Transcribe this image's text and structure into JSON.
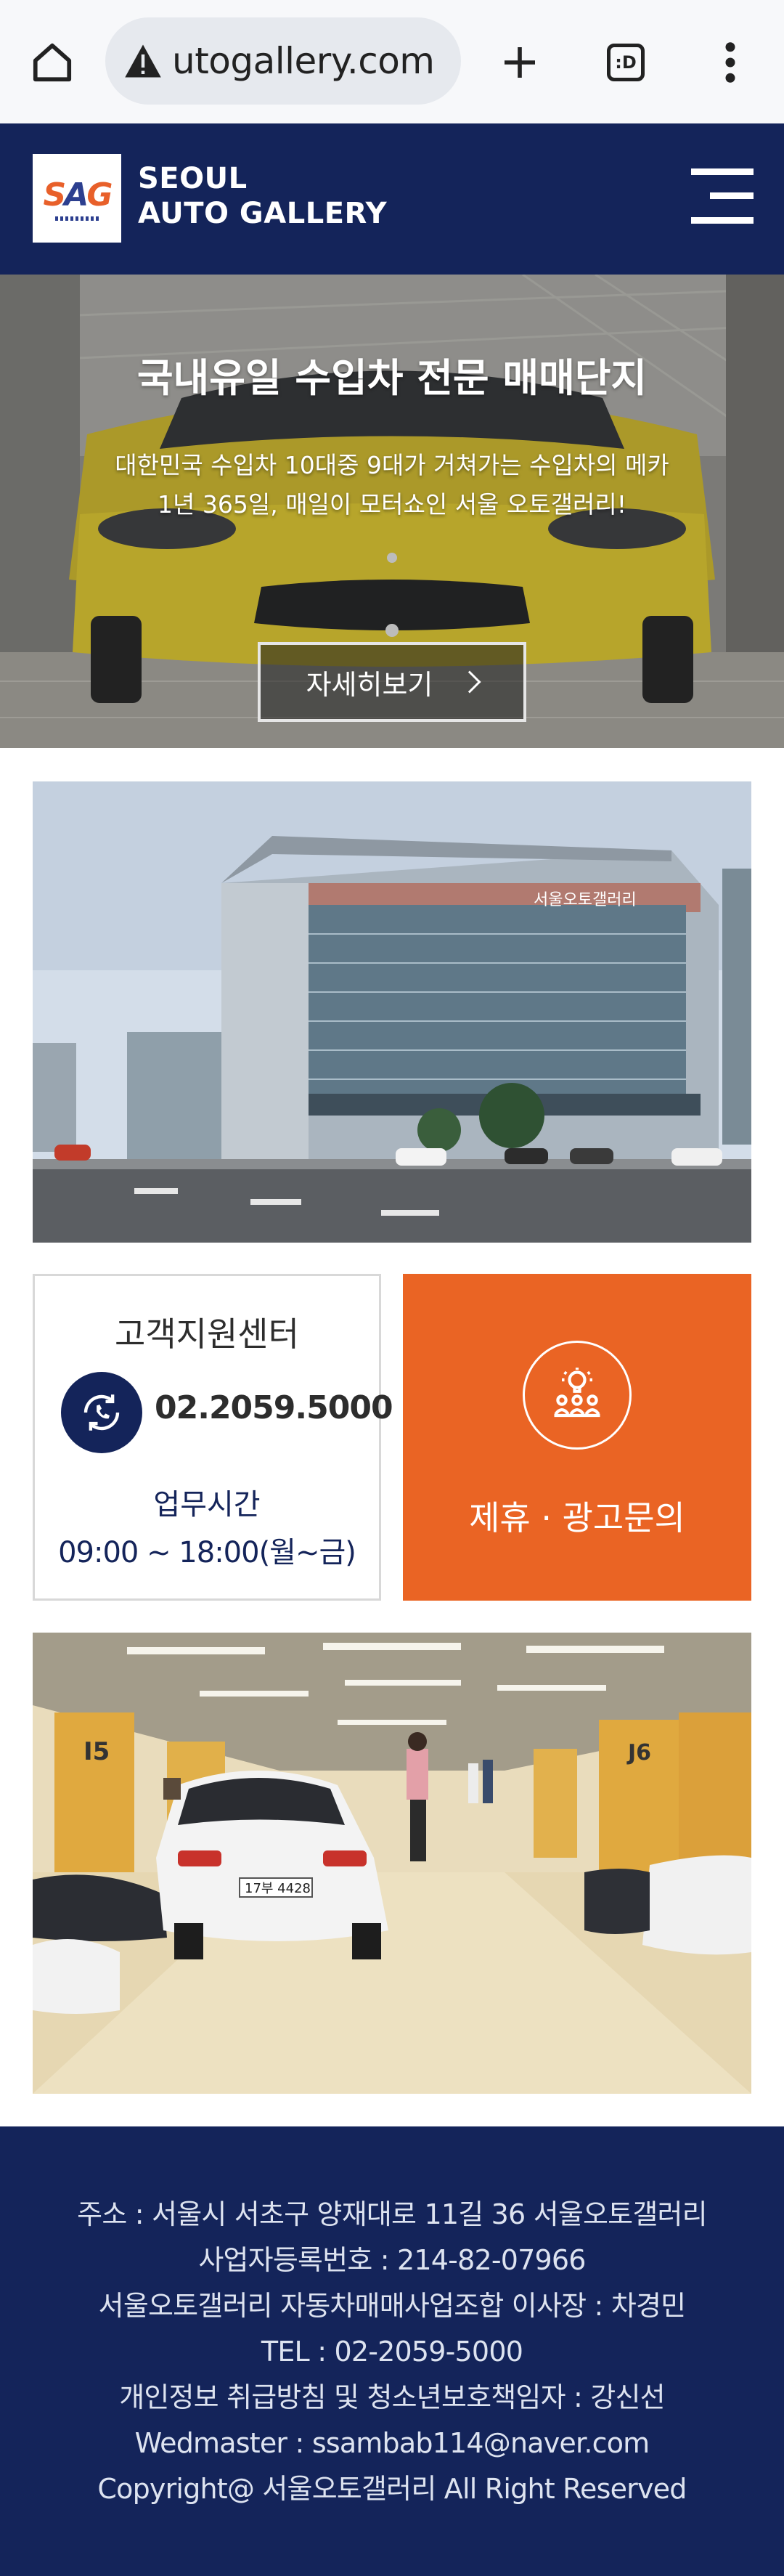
{
  "browser": {
    "url_display": "utogallery.com",
    "tab_switcher_label": ":D"
  },
  "header": {
    "logo_text": "SAG",
    "brand_line1": "SEOUL",
    "brand_line2": "AUTO GALLERY"
  },
  "hero": {
    "title": "국내유일 수입차 전문 매매단지",
    "subtitle_line1": "대한민국 수입차 10대중 9대가 거쳐가는 수입차의 메카",
    "subtitle_line2": "1년 365일, 매일이 모터쇼인 서울 오토갤러리!",
    "button_label": "자세히보기"
  },
  "building_photo": {
    "sign_text": "서울오토갤러리"
  },
  "support": {
    "title": "고객지원센터",
    "phone": "02.2059.5000",
    "hours_label": "업무시간",
    "hours_value": "09:00 ~ 18:00(월~금)"
  },
  "partner": {
    "label": "제휴 · 광고문의"
  },
  "showroom_photo": {
    "plate_text": "17부 4428"
  },
  "footer": {
    "lines": [
      "주소 : 서울시 서초구 양재대로 11길 36 서울오토갤러리",
      "사업자등록번호 : 214-82-07966",
      "서울오토갤러리 자동차매매사업조합 이사장 : 차경민",
      "TEL : 02-2059-5000",
      "개인정보 취급방침 및 청소년보호책임자 : 강신선",
      "Wedmaster : ssambab114@naver.com",
      "Copyright@ 서울오토갤러리 All Right Reserved"
    ]
  },
  "colors": {
    "navy": "#14245a",
    "orange": "#ea6424",
    "white": "#ffffff"
  }
}
